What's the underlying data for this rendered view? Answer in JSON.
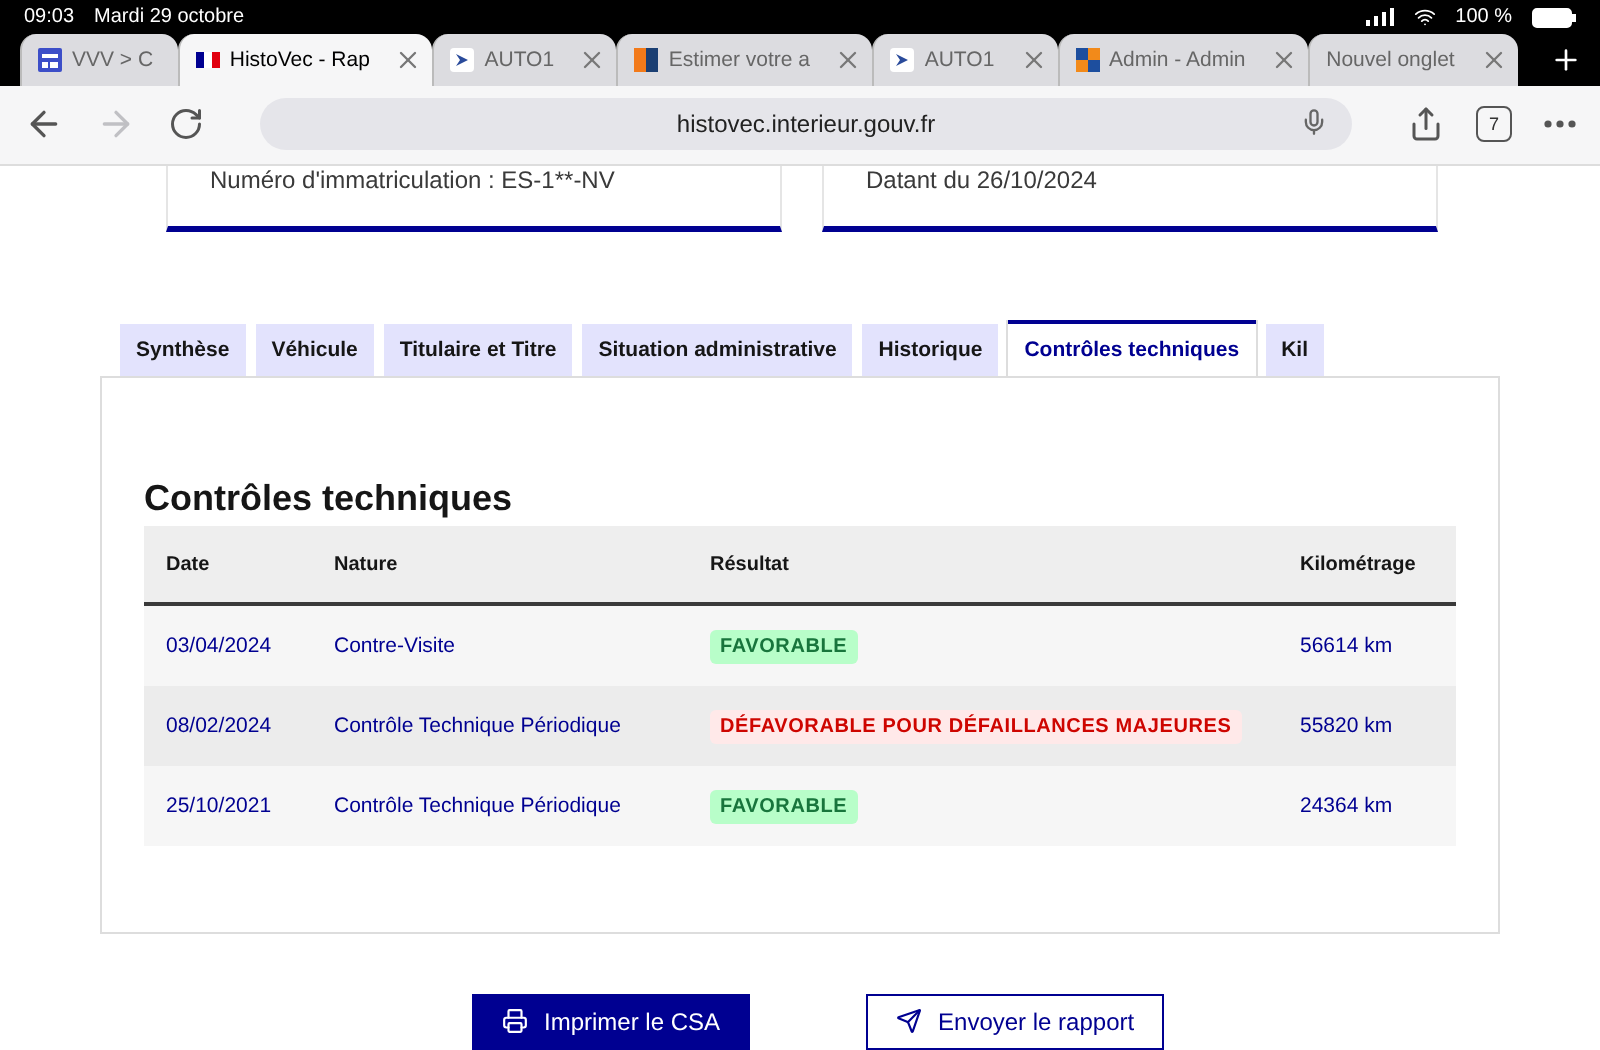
{
  "status_bar": {
    "time": "09:03",
    "date": "Mardi 29 octobre",
    "battery": "100 %"
  },
  "browser_tabs": [
    {
      "title": "VVV > C",
      "selected": false
    },
    {
      "title": "HistoVec - Rap",
      "selected": true
    },
    {
      "title": "AUTO1",
      "selected": false
    },
    {
      "title": "Estimer votre a",
      "selected": false
    },
    {
      "title": "AUTO1",
      "selected": false
    },
    {
      "title": "Admin - Admin",
      "selected": false
    },
    {
      "title": "Nouvel onglet",
      "selected": false
    }
  ],
  "toolbar": {
    "url": "histovec.interieur.gouv.fr",
    "tab_count": "7",
    "forward_disabled": true
  },
  "info_cards": [
    {
      "text": "Numéro d'immatriculation : ES-1**-NV"
    },
    {
      "text": "Datant du 26/10/2024"
    }
  ],
  "page_tabs": [
    {
      "label": "Synthèse",
      "selected": false
    },
    {
      "label": "Véhicule",
      "selected": false
    },
    {
      "label": "Titulaire et Titre",
      "selected": false
    },
    {
      "label": "Situation administrative",
      "selected": false
    },
    {
      "label": "Historique",
      "selected": false
    },
    {
      "label": "Contrôles techniques",
      "selected": true
    },
    {
      "label": "Kil",
      "selected": false
    }
  ],
  "section_title": "Contrôles techniques",
  "table": {
    "columns": [
      "Date",
      "Nature",
      "Résultat",
      "Kilométrage"
    ],
    "rows": [
      {
        "date": "03/04/2024",
        "nature": "Contre-Visite",
        "result": "FAVORABLE",
        "kind": "success",
        "mileage": "56614 km"
      },
      {
        "date": "08/02/2024",
        "nature": "Contrôle Technique Périodique",
        "result": "DÉFAVORABLE POUR DÉFAILLANCES MAJEURES",
        "kind": "error",
        "mileage": "55820 km"
      },
      {
        "date": "25/10/2021",
        "nature": "Contrôle Technique Périodique",
        "result": "FAVORABLE",
        "kind": "success",
        "mileage": "24364 km"
      }
    ]
  },
  "actions": [
    {
      "label": "Imprimer le CSA",
      "kind": "primary"
    },
    {
      "label": "Envoyer le rapport",
      "kind": "secondary"
    }
  ]
}
